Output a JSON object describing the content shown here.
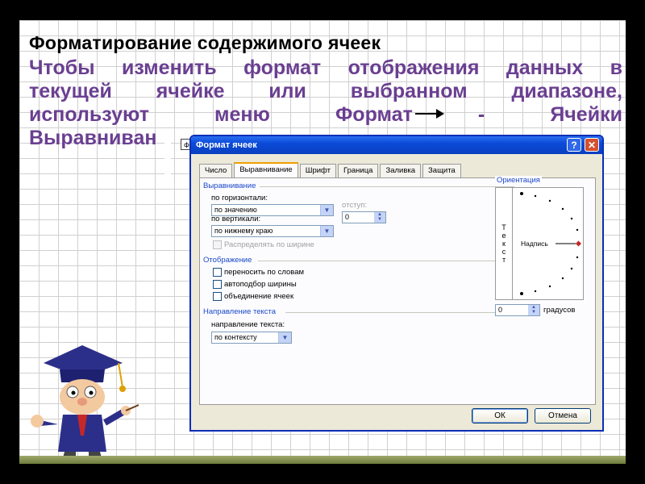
{
  "slide": {
    "title": "Форматирование  содержимого  ячеек",
    "paragraph_lines": [
      [
        "Чтобы",
        "изменить",
        "формат",
        "отображения",
        "данных",
        "в"
      ],
      [
        "текущей",
        "ячейке",
        "или",
        "выбранном",
        "диапазоне,"
      ],
      [
        "используют",
        "меню",
        "Формат",
        "-",
        "Ячейки"
      ],
      [
        "Выравниван"
      ]
    ],
    "menu_tag": "Формат"
  },
  "dialog": {
    "title": "Формат ячеек",
    "help_label": "?",
    "close_label": "✕",
    "tabs": [
      {
        "label": "Число",
        "active": false
      },
      {
        "label": "Выравнивание",
        "active": true
      },
      {
        "label": "Шрифт",
        "active": false
      },
      {
        "label": "Граница",
        "active": false
      },
      {
        "label": "Заливка",
        "active": false
      },
      {
        "label": "Защита",
        "active": false
      }
    ],
    "alignment": {
      "group": "Выравнивание",
      "horizontal_label": "по горизонтали:",
      "horizontal_value": "по значению",
      "indent_label": "отступ:",
      "indent_value": "0",
      "vertical_label": "по вертикали:",
      "vertical_value": "по нижнему краю",
      "distribute_label": "Распределять по ширине"
    },
    "display": {
      "group": "Отображение",
      "wrap_label": "переносить по словам",
      "autofit_label": "автоподбор ширины",
      "merge_label": "объединение ячеек"
    },
    "text_direction": {
      "group": "Направление текста",
      "label": "направление текста:",
      "value": "по контексту"
    },
    "orientation": {
      "group": "Ориентация",
      "vertical_letters": [
        "Т",
        "е",
        "к",
        "с",
        "т"
      ],
      "caption": "Надпись",
      "degrees_value": "0",
      "degrees_label": "градусов"
    },
    "ok_label": "ОК",
    "cancel_label": "Отмена"
  },
  "colors": {
    "heading_purple": "#6a3f91",
    "titlebar_blue": "#0b4ad8",
    "dialog_face": "#ece9d8",
    "group_header_blue": "#1a48c8"
  }
}
